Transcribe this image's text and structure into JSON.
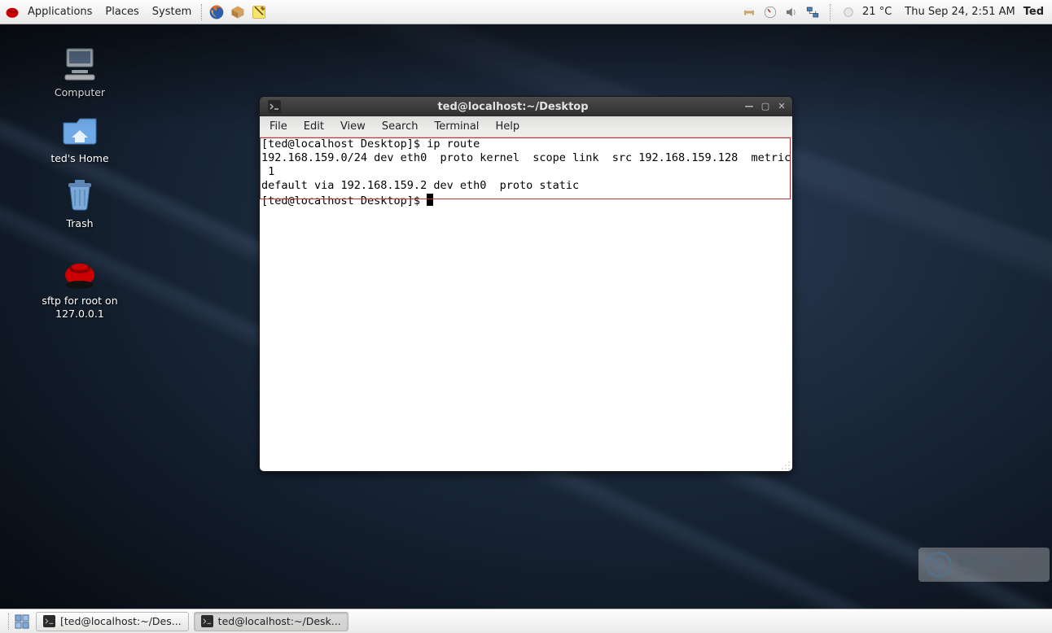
{
  "top_panel": {
    "menus": {
      "applications": "Applications",
      "places": "Places",
      "system": "System"
    },
    "tray": {
      "temperature": "21 °C",
      "datetime": "Thu Sep 24,  2:51 AM"
    },
    "user": "Ted"
  },
  "desktop_icons": {
    "computer": "Computer",
    "home": "ted's Home",
    "trash": "Trash",
    "sftp": "sftp for root on 127.0.0.1"
  },
  "terminal": {
    "title": "ted@localhost:~/Desktop",
    "menus": {
      "file": "File",
      "edit": "Edit",
      "view": "View",
      "search": "Search",
      "terminal": "Terminal",
      "help": "Help"
    },
    "lines": {
      "l1": "[ted@localhost Desktop]$ ip route",
      "l2": "192.168.159.0/24 dev eth0  proto kernel  scope link  src 192.168.159.128  metric",
      "l3": " 1",
      "l4": "default via 192.168.159.2 dev eth0  proto static",
      "l5": "[ted@localhost Desktop]$ "
    }
  },
  "tasks": {
    "t1": "[ted@localhost:~/Des...",
    "t2": "ted@localhost:~/Desk..."
  },
  "watermark": {
    "brand": "创新互联",
    "sub": "CHUANG XIN HU LIAN"
  }
}
